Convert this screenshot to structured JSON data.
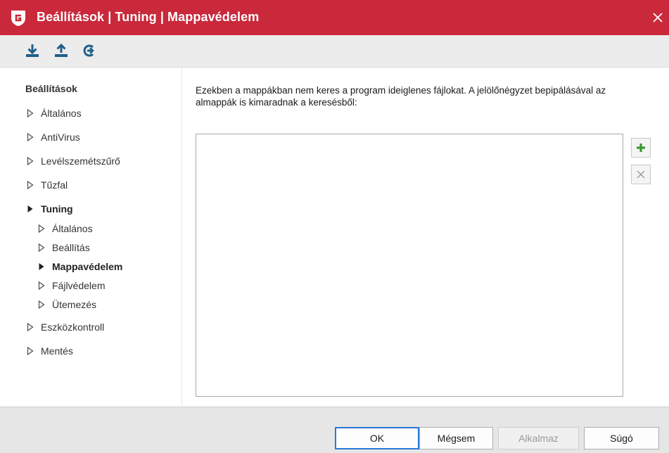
{
  "window": {
    "title": "Beállítások | Tuning | Mappavédelem"
  },
  "toolbar": {
    "buttons": [
      {
        "icon": "import-icon"
      },
      {
        "icon": "export-icon"
      },
      {
        "icon": "reset-icon"
      }
    ]
  },
  "sidebar": {
    "heading": "Beállítások",
    "items": [
      {
        "label": "Általános",
        "expanded": false,
        "selected": false,
        "level": 0
      },
      {
        "label": "AntiVirus",
        "expanded": false,
        "selected": false,
        "level": 0
      },
      {
        "label": "Levélszemétszűrő",
        "expanded": false,
        "selected": false,
        "level": 0
      },
      {
        "label": "Tűzfal",
        "expanded": false,
        "selected": false,
        "level": 0
      },
      {
        "label": "Tuning",
        "expanded": true,
        "selected": false,
        "level": 0
      },
      {
        "label": "Általános",
        "expanded": false,
        "selected": false,
        "level": 1
      },
      {
        "label": "Beállítás",
        "expanded": false,
        "selected": false,
        "level": 1
      },
      {
        "label": "Mappavédelem",
        "expanded": false,
        "selected": true,
        "level": 1
      },
      {
        "label": "Fájlvédelem",
        "expanded": false,
        "selected": false,
        "level": 1
      },
      {
        "label": "Ütemezés",
        "expanded": false,
        "selected": false,
        "level": 1
      },
      {
        "label": "Eszközkontroll",
        "expanded": false,
        "selected": false,
        "level": 0
      },
      {
        "label": "Mentés",
        "expanded": false,
        "selected": false,
        "level": 0
      }
    ]
  },
  "main": {
    "description": "Ezekben a mappákban nem keres a program ideiglenes fájlokat. A jelölőnégyzet bepipálásával az almappák is kimaradnak a keresésből:",
    "list_items": [],
    "add_icon": "plus-icon",
    "remove_icon": "remove-icon"
  },
  "footer": {
    "ok": "OK",
    "cancel": "Mégsem",
    "apply": "Alkalmaz",
    "help": "Súgó"
  },
  "colors": {
    "titlebar": "#c9293b",
    "accent": "#2b78d6",
    "toolbar_icon": "#1f5f8b",
    "add_icon": "#3a9a2f"
  }
}
